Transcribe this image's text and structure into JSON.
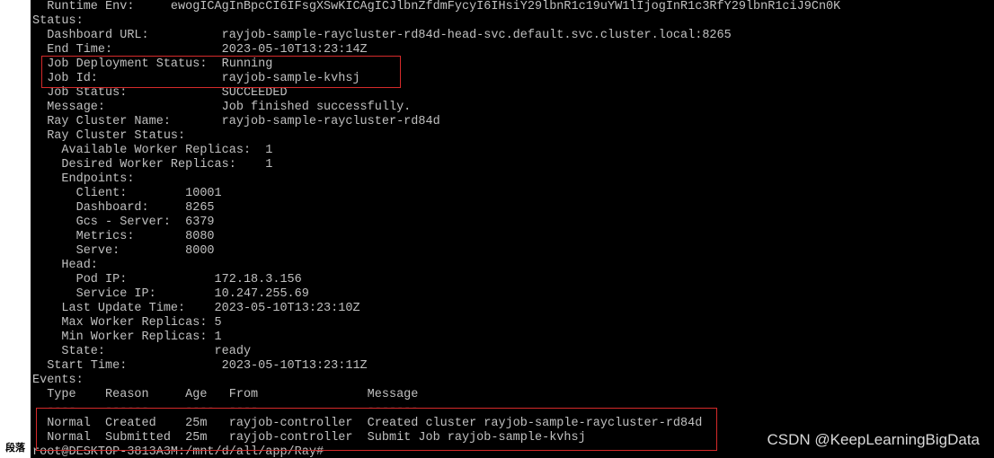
{
  "terminal": {
    "lines": [
      "  Runtime Env:     ewogICAgInBpcCI6IFsgXSwKICAgICJlbnZfdmFycyI6IHsiY29lbnR1c19uYW1lIjogInR1c3RfY29lbnR1ciJ9Cn0K",
      "Status:",
      "  Dashboard URL:          rayjob-sample-raycluster-rd84d-head-svc.default.svc.cluster.local:8265",
      "  End Time:               2023-05-10T13:23:14Z",
      "  Job Deployment Status:  Running",
      "  Job Id:                 rayjob-sample-kvhsj",
      "  Job Status:             SUCCEEDED",
      "  Message:                Job finished successfully.",
      "  Ray Cluster Name:       rayjob-sample-raycluster-rd84d",
      "  Ray Cluster Status:",
      "    Available Worker Replicas:  1",
      "    Desired Worker Replicas:    1",
      "    Endpoints:",
      "      Client:        10001",
      "      Dashboard:     8265",
      "      Gcs - Server:  6379",
      "      Metrics:       8080",
      "      Serve:         8000",
      "    Head:",
      "      Pod IP:            172.18.3.156",
      "      Service IP:        10.247.255.69",
      "    Last Update Time:    2023-05-10T13:23:10Z",
      "    Max Worker Replicas: 5",
      "    Min Worker Replicas: 1",
      "    State:               ready",
      "  Start Time:             2023-05-10T13:23:11Z",
      "Events:",
      "  Type    Reason     Age   From               Message",
      "  ----    ------     ----  ----               -------",
      "  Normal  Created    25m   rayjob-controller  Created cluster rayjob-sample-raycluster-rd84d",
      "  Normal  Submitted  25m   rayjob-controller  Submit Job rayjob-sample-kvhsj",
      "root@DESKTOP-3813A3M:/mnt/d/all/app/Ray#"
    ]
  },
  "watermark": "CSDN @KeepLearningBigData",
  "ime_label": "段落",
  "colors": {
    "background": "#000000",
    "text": "#c0c0c0",
    "highlight_box": "#d62a2a"
  }
}
